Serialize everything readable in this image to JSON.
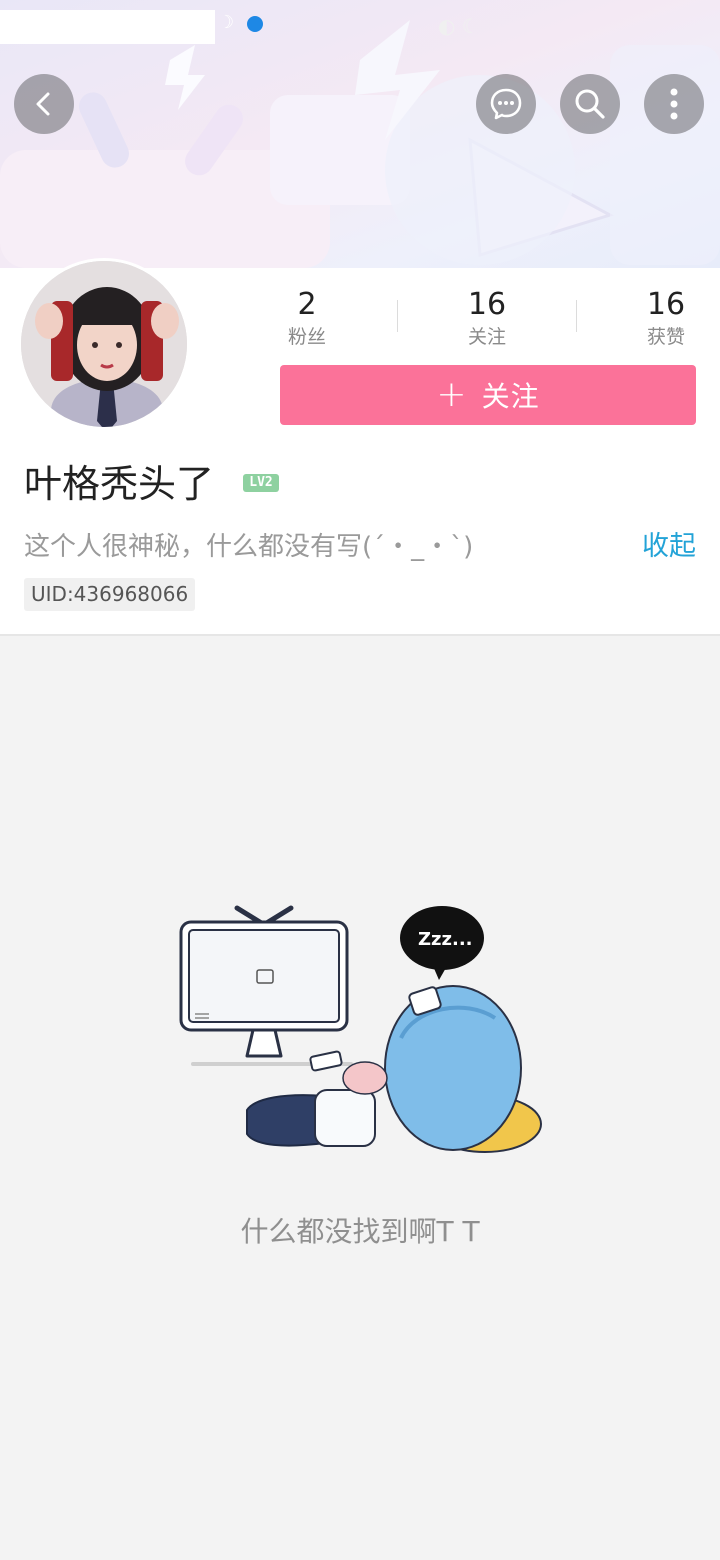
{
  "header": {
    "back_icon": "chevron-left-icon",
    "actions": [
      "chat-icon",
      "search-icon",
      "more-vertical-icon"
    ]
  },
  "profile": {
    "stats": [
      {
        "value": "2",
        "label": "粉丝"
      },
      {
        "value": "16",
        "label": "关注"
      },
      {
        "value": "16",
        "label": "获赞"
      }
    ],
    "follow_button": {
      "icon": "+",
      "label": "关注"
    },
    "name": "叶格秃头了",
    "level_badge": "LV2",
    "bio": "这个人很神秘，什么都没有写(´・_・`)",
    "collapse_label": "收起",
    "uid": "UID:436968066"
  },
  "empty_state": {
    "message": "什么都没找到啊T T",
    "bubble_text": "Zzz..."
  },
  "colors": {
    "accent_pink": "#fb7299",
    "link_blue": "#23a3d7",
    "level_green": "#8ed1a0"
  }
}
